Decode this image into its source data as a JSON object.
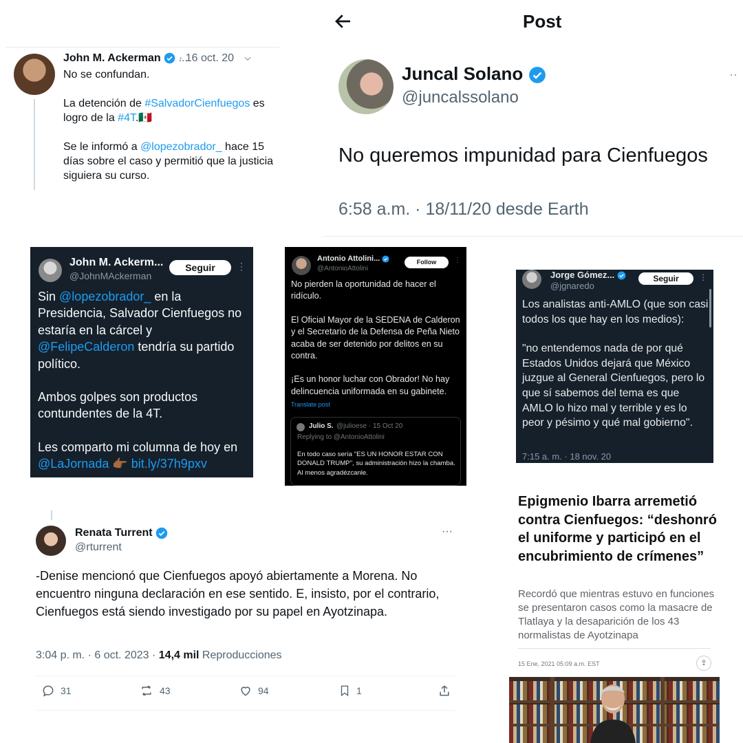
{
  "tweet_ackerman_1": {
    "name": "John M. Ackerman",
    "dots": "...",
    "date": "· 16 oct. 20",
    "line1": "No se confundan.",
    "line2_pre": "La detención de ",
    "line2_tag": "#SalvadorCienfuegos",
    "line2_mid": " es logro de la ",
    "line2_tag2": "#4T",
    "line2_end": ".",
    "flag": "🇲🇽",
    "line3_pre": "Se le informó a ",
    "line3_mention": "@lopezobrador_",
    "line3_end": " hace 15 días sobre el caso y permitió que la justicia siguiera su curso."
  },
  "post_juncal": {
    "back": "←",
    "title": "Post",
    "name": "Juncal Solano",
    "handle": "@juncalssolano",
    "dots": "··",
    "text": "No queremos impunidad para Cienfuegos",
    "time": "6:58 a.m. · 18/11/20 desde Earth"
  },
  "tweet_ackerman_2": {
    "name": "John M. Ackerm...",
    "handle": "@JohnMAckerman",
    "follow": "Seguir",
    "dots": "⋮",
    "p1_a": "Sin ",
    "p1_mention": "@lopezobrador_",
    "p1_b": " en la Presidencia, Salvador Cienfuegos no estaría en la cárcel y ",
    "p1_mention2": "@FelipeCalderon",
    "p1_c": " tendría su partido político.",
    "p2": "Ambos golpes son productos contundentes de la 4T.",
    "p3_a": "Les comparto mi columna de hoy en  ",
    "p3_mention": "@LaJornada",
    "p3_emoji": " 👉🏾 ",
    "p3_link": "bit.ly/37h9pxv"
  },
  "tweet_attolini": {
    "name": "Antonio Attolini...",
    "handle": "@AntonioAttolini",
    "follow": "Follow",
    "dots": "⋮",
    "p1": "No pierden la oportunidad de hacer el ridículo.",
    "p2": "El Oficial Mayor de la SEDENA de Calderon y el Secretario de la Defensa de Peña Nieto acaba de ser detenido por delitos en su contra.",
    "p3": "¡Es un honor luchar con Obrador! No hay delincuencia uniformada en su gabinete.",
    "translate": "Translate post",
    "quote": {
      "name": "Julio S.",
      "meta": "@julioese · 15 Oct 20",
      "reply": "Replying to @AntonioAttolini",
      "body": "En todo caso sería \"ES UN HONOR ESTAR CON DONALD TRUMP\", su administración hizo la chamba. Al menos agradézcanle."
    }
  },
  "tweet_jorge": {
    "name": "Jorge Gómez...",
    "handle": "@jgnaredo",
    "follow": "Seguir",
    "dots": "⋮",
    "p1": "Los analistas anti-AMLO (que son casi todos los que hay en los medios):",
    "p2": "\"no entendemos nada de por qué Estados Unidos dejará que México juzgue al General Cienfuegos, pero lo que sí sabemos del tema es que AMLO lo hizo mal y terrible y es lo peor y pésimo y qué mal gobierno\".",
    "time": "7:15 a. m. · 18 nov. 20"
  },
  "tweet_renata": {
    "name": "Renata Turrent",
    "handle": "@rturrent",
    "dots": "···",
    "body": "-Denise mencionó que Cienfuegos apoyó abiertamente a Morena. No encuentro ninguna declaración en ese sentido. E, insisto, por el contrario, Cienfuegos está siendo investigado por su papel en Ayotzinapa.",
    "time": "3:04 p. m. · 6 oct. 2023 · ",
    "views": "14,4 mil",
    "views_label": " Reproducciones",
    "replies": "31",
    "retweets": "43",
    "likes": "94",
    "bookmarks": "1"
  },
  "article": {
    "headline": "Epigmenio Ibarra arremetió contra Cienfuegos: “deshonró el uniforme y participó en el encubrimiento de crímenes”",
    "subhead": "Recordó que mientras estuvo en funciones se presentaron casos como la masacre de Tlatlaya y la desaparición de los 43 normalistas de Ayotzinapa",
    "date": "15 Ene, 2021 05:09 a.m. EST",
    "share_icon": "⇪"
  },
  "colors": {
    "link": "#1d9bf0",
    "dim_bg": "#15202b",
    "black_bg": "#000000",
    "verified": "#1d9bf0"
  }
}
